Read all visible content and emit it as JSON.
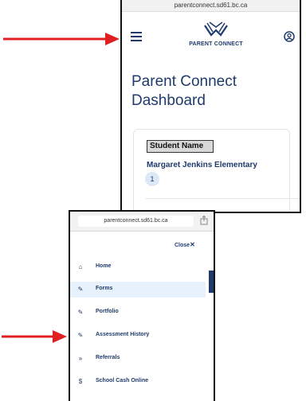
{
  "screenshot_top": {
    "url": "parentconnect.sd61.bc.ca",
    "logo_text": "PARENT CONNECT",
    "title": "Parent Connect Dashboard",
    "student_name_label": "Student Name",
    "school_name": "Margaret Jenkins Elementary",
    "grade_badge": "1"
  },
  "screenshot_bottom": {
    "url": "parentconnect.sd61.bc.ca",
    "close_label": "Close",
    "close_icon": "✕",
    "menu": [
      {
        "label": "Home",
        "icon": "home-icon",
        "glyph": "⌂",
        "active": false
      },
      {
        "label": "Forms",
        "icon": "pen-icon",
        "glyph": "✎",
        "active": true
      },
      {
        "label": "Portfolio",
        "icon": "pen-icon",
        "glyph": "✎",
        "active": false
      },
      {
        "label": "Assessment History",
        "icon": "pen-icon",
        "glyph": "✎",
        "active": false
      },
      {
        "label": "Referrals",
        "icon": "double-chevron-icon",
        "glyph": "»",
        "active": false
      },
      {
        "label": "School Cash Online",
        "icon": "dollar-icon",
        "glyph": "$",
        "active": false
      }
    ]
  },
  "colors": {
    "brand_navy": "#1f3a6b",
    "arrow_red": "#e02020",
    "active_row": "#e6f1fb"
  }
}
